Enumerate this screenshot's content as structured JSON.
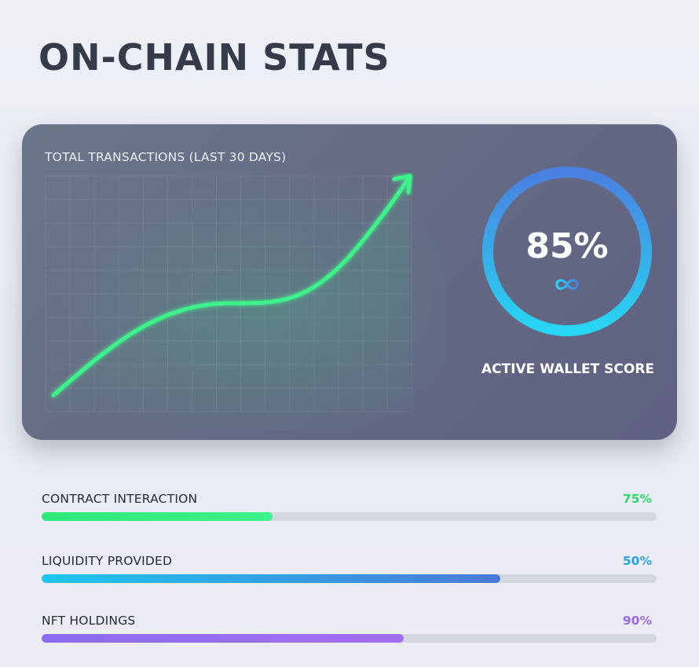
{
  "page": {
    "title": "ON-CHAIN STATS"
  },
  "stats_card": {
    "chart_title": "TOTAL TRANSACTIONS (LAST 30 DAYS)",
    "trend_color": "#3df28a",
    "gauge": {
      "value": 85,
      "value_text": "85%",
      "label": "ACTIVE WALLET SCORE",
      "icon": "link-icon",
      "colors": [
        "#27d6f2",
        "#4a80e0"
      ]
    }
  },
  "metrics": [
    {
      "label": "CONTRACT INTERACTION",
      "value_text": "75%",
      "fill_fraction": 0.375,
      "value_color": "#2fd86f",
      "fill_colors": [
        "#2ee87a",
        "#3df28a"
      ]
    },
    {
      "label": "LIQUIDITY PROVIDED",
      "value_text": "50%",
      "fill_fraction": 0.746,
      "value_color": "#2aa2e6",
      "fill_colors": [
        "#1ec6f0",
        "#4a7ad8"
      ]
    },
    {
      "label": "NFT HOLDINGS",
      "value_text": "90%",
      "fill_fraction": 0.589,
      "value_color": "#9a6ae6",
      "fill_colors": [
        "#8a6cf0",
        "#a56ef0"
      ]
    }
  ]
}
